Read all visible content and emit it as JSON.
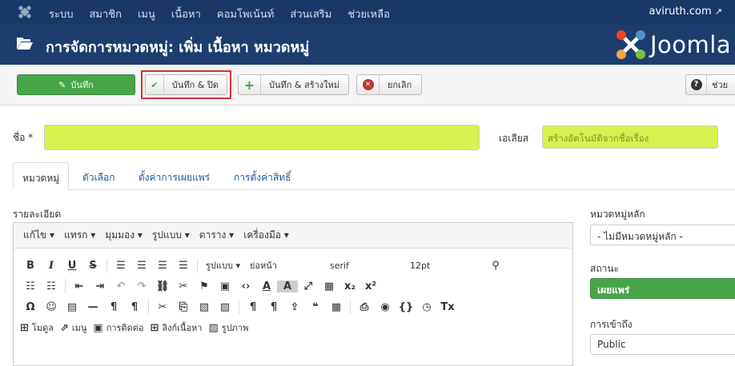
{
  "topnav": {
    "items": [
      "ระบบ",
      "สมาชิก",
      "เมนู",
      "เนื้อหา",
      "คอมโพเน้นท์",
      "ส่วนเสริม",
      "ช่วยเหลือ"
    ],
    "site": "aviruth.com"
  },
  "header": {
    "title": "การจัดการหมวดหมู่: เพิ่ม เนื้อหา หมวดหมู่",
    "brand": "Joomla"
  },
  "toolbar": {
    "save": "บันทึก",
    "save_close": "บันทึก & ปิด",
    "save_new": "บันทึก & สร้างใหม่",
    "cancel": "ยกเลิก",
    "help": "ช่วย"
  },
  "form": {
    "name_label": "ชื่อ *",
    "alias_label": "เอเลียส",
    "alias_placeholder": "สร้างอัตโนมัติจากชื่อเรื่อง"
  },
  "tabs": [
    "หมวดหมู่",
    "ตัวเลือก",
    "ตั้งค่าการเผยแพร่",
    "การตั้งค่าสิทธิ์"
  ],
  "editor": {
    "label": "รายละเอียด",
    "menubar": [
      "แก้ไข ▾",
      "แทรก ▾",
      "มุมมอง ▾",
      "รูปแบบ ▾",
      "ตาราง ▾",
      "เครื่องมือ ▾"
    ],
    "format_select": "รูปแบบ",
    "para_select": "ย่อหน้า",
    "font_select": "serif",
    "size_select": "12pt",
    "xtd_buttons": [
      "โมดูล",
      "เมนู",
      "การติดต่อ",
      "ลิงก์เนื้อหา",
      "รูปภาพ"
    ]
  },
  "sidebar": {
    "parent_label": "หมวดหมู่หลัก",
    "parent_value": "- ไม่มีหมวดหมู่หลัก -",
    "status_label": "สถานะ",
    "status_value": "เผยแพร่",
    "access_label": "การเข้าถึง",
    "access_value": "Public"
  },
  "colors": {
    "topnav": "#1a3867",
    "header": "#1c3d6e",
    "save_green": "#46a546",
    "highlight": "#d9303a",
    "field_yellow": "#d6f24e"
  }
}
